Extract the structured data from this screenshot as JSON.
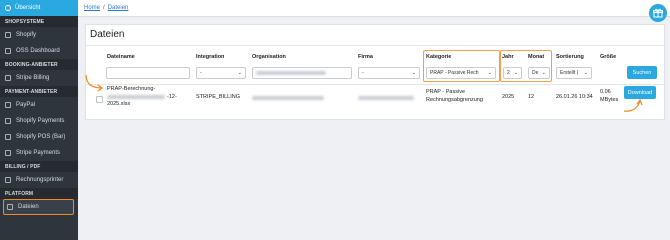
{
  "sidebar": {
    "top_label": "Übersicht",
    "groups": [
      {
        "title": "SHOPSYSTEME",
        "items": [
          {
            "label": "Shopify",
            "icon": "bag-icon"
          },
          {
            "label": "OSS Dashboard",
            "icon": "chart-icon"
          }
        ]
      },
      {
        "title": "BOOKING-ANBIETER",
        "items": [
          {
            "label": "Stripe Billing",
            "icon": "card-icon"
          }
        ]
      },
      {
        "title": "PAYMENT-ANBIETER",
        "items": [
          {
            "label": "PayPal",
            "icon": "card-icon"
          },
          {
            "label": "Shopify Payments",
            "icon": "card-icon"
          },
          {
            "label": "Shopify POS (Bar)",
            "icon": "card-icon"
          },
          {
            "label": "Stripe Payments",
            "icon": "card-icon"
          }
        ]
      },
      {
        "title": "BILLING / PDF",
        "items": [
          {
            "label": "Rechnungsprinter",
            "icon": "file-icon"
          }
        ]
      },
      {
        "title": "PLATFORM",
        "items": [
          {
            "label": "Dateien",
            "icon": "file-icon"
          }
        ]
      }
    ]
  },
  "breadcrumb": {
    "home": "Home",
    "current": "Dateien"
  },
  "page": {
    "title": "Dateien"
  },
  "table": {
    "headers": {
      "dateiname": "Dateiname",
      "integration": "Integration",
      "organisation": "Organisation",
      "firma": "Firma",
      "kategorie": "Kategorie",
      "jahr": "Jahr",
      "monat": "Monat",
      "sortierung": "Sortierung",
      "groesse": "Größe"
    },
    "filters": {
      "integration": "-",
      "firma": "-",
      "kategorie": "PRAP - Passive Rech",
      "jahr": "2",
      "monat": "De",
      "sortierung": "Erstellt ("
    },
    "search_button": "Suchen",
    "row": {
      "file_line1": "PRAP-Berechnung-",
      "file_line2": "-12-",
      "file_line3": "2025.xlsx",
      "integration": "STRIPE_BILLING",
      "kategorie_line1": "PRAP - Passive",
      "kategorie_line2": "Rechnungsabgrenzung",
      "jahr": "2025",
      "monat": "12",
      "sortierung": "26.01.26 10:34",
      "groesse_line1": "0.06",
      "groesse_line2": "MBytes",
      "download_button": "Download"
    }
  },
  "colors": {
    "accent": "#2aa8e0",
    "highlight": "#f08a24",
    "sidebar": "#2f353d"
  }
}
